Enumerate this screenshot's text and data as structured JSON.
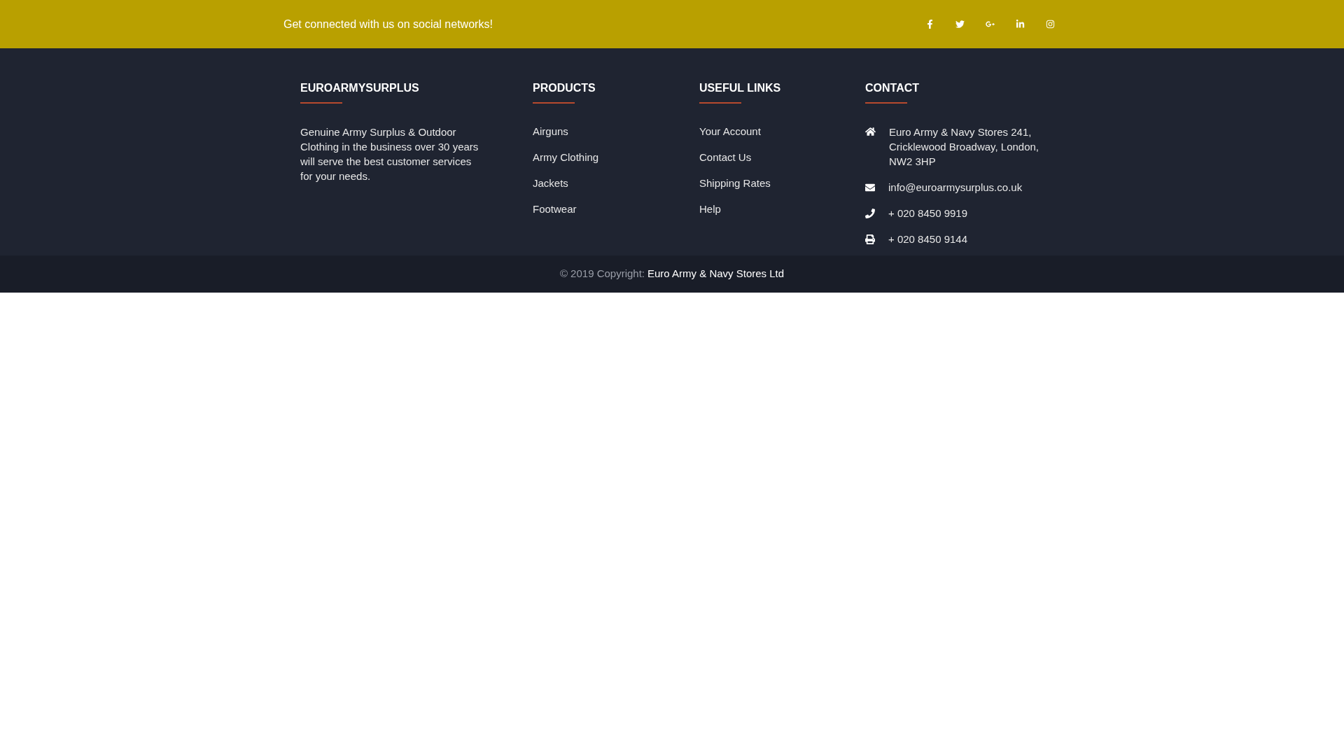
{
  "top_bar": {
    "tagline": "Get connected with us on social networks!",
    "social_links": [
      {
        "kind": "facebook"
      },
      {
        "kind": "twitter"
      },
      {
        "kind": "google-plus"
      },
      {
        "kind": "linkedin"
      },
      {
        "kind": "instagram"
      }
    ]
  },
  "footer": {
    "about": {
      "title": "EUROARMYSURPLUS",
      "text": "Genuine Army Surplus & Outdoor Clothing in the business over 30 years will serve the best customer services for your needs."
    },
    "products": {
      "title": "PRODUCTS",
      "links": [
        "Airguns",
        "Army Clothing",
        "Jackets",
        "Footwear"
      ]
    },
    "useful_links": {
      "title": "USEFUL LINKS",
      "links": [
        "Your Account",
        "Contact Us",
        "Shipping Rates",
        "Help"
      ]
    },
    "contact": {
      "title": "CONTACT",
      "items": [
        {
          "kind": "address",
          "text": "Euro Army & Navy Stores 241, Cricklewood Broadway, London, NW2 3HP"
        },
        {
          "kind": "email",
          "text": "info@euroarmysurplus.co.uk"
        },
        {
          "kind": "phone",
          "text": "+ 020 8450 9919"
        },
        {
          "kind": "fax",
          "text": "+ 020 8450 9144"
        }
      ]
    }
  },
  "copyright": {
    "prefix": "© 2019 Copyright:",
    "link": "Euro Army & Navy Stores Ltd"
  }
}
